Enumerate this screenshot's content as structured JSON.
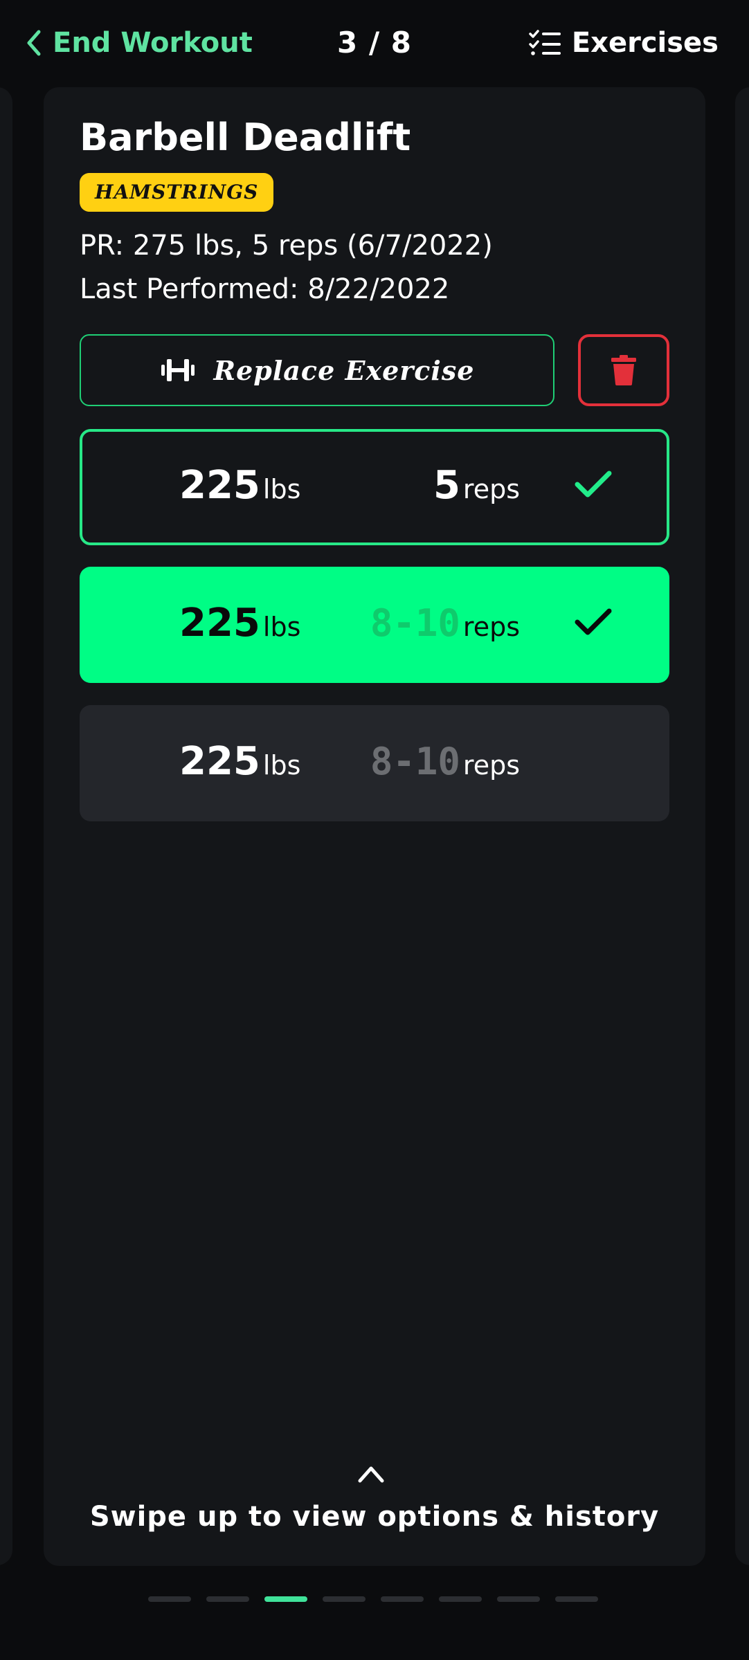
{
  "header": {
    "back_label": "End Workout",
    "counter": "3 / 8",
    "exercises_label": "Exercises"
  },
  "exercise": {
    "title": "Barbell Deadlift",
    "muscle": "HAMSTRINGS",
    "pr": "PR: 275 lbs, 5 reps (6/7/2022)",
    "last_performed": "Last Performed: 8/22/2022",
    "replace_label": "Replace Exercise"
  },
  "sets": [
    {
      "weight": "225",
      "weight_unit": "lbs",
      "reps": "5",
      "reps_unit": "reps",
      "state": "logged"
    },
    {
      "weight": "225",
      "weight_unit": "lbs",
      "reps": "8-10",
      "reps_unit": "reps",
      "state": "active"
    },
    {
      "weight": "225",
      "weight_unit": "lbs",
      "reps": "8-10",
      "reps_unit": "reps",
      "state": "pending"
    }
  ],
  "footer": {
    "swipe_hint": "Swipe up to view options & history"
  },
  "pagination": {
    "total": 8,
    "current": 3
  },
  "colors": {
    "accent": "#00fd85",
    "accent_text": "#5fe3a1",
    "danger": "#e3303a",
    "badge": "#ffd012",
    "card": "#141619",
    "background": "#0b0c0e"
  },
  "icons": [
    "chevron-left-icon",
    "checklist-icon",
    "dumbbell-icon",
    "trash-icon",
    "checkmark-icon",
    "chevron-up-icon"
  ]
}
